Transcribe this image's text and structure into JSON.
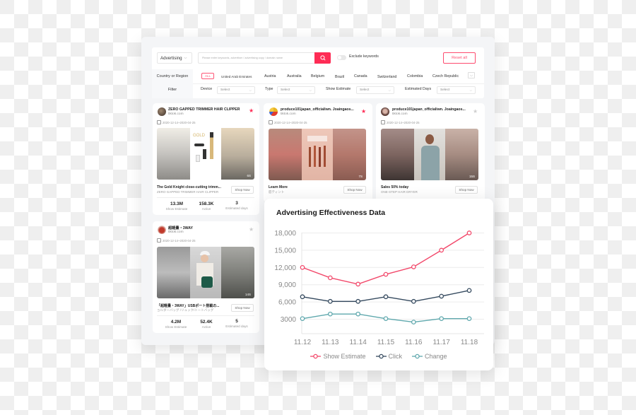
{
  "search": {
    "type_select": "Advertising",
    "placeholder": "Please enter keywords, advertiser / advertising copy / domain name",
    "exclude_label": "Exclude keywords",
    "reset_label": "Reset all"
  },
  "country_filter": {
    "label": "Country or Region",
    "options": [
      "ALL",
      "United Arab Emirates",
      "Austria",
      "Australia",
      "Belgium",
      "Brazil",
      "Canada",
      "Switzerland",
      "Colombia",
      "Czech Republic"
    ]
  },
  "filters": {
    "label": "Filter",
    "items": [
      {
        "label": "Device",
        "value": "Select"
      },
      {
        "label": "Type",
        "value": "Select"
      },
      {
        "label": "Show Estimate",
        "value": "Select"
      },
      {
        "label": "Estimated Days",
        "value": "Select"
      }
    ]
  },
  "ads": [
    {
      "title": "ZERO GAPPED TRIMMER HAIR CLIPPER",
      "domain": "tiktok.com",
      "starred": true,
      "date": "2020-12-14~2020-04-25",
      "duration": "6S",
      "caption": "The Gold Knight close-cutting trimm...",
      "sub": "ZERO GAPPED TRIMMER HAIR CLIPPER",
      "shop_label": "Shop Now",
      "stats": [
        {
          "value": "13.3M",
          "label": "Show Estimate"
        },
        {
          "value": "158.3K",
          "label": "Active"
        },
        {
          "value": "3",
          "label": "Estimated days"
        }
      ]
    },
    {
      "title": "produce101japan_officialiwn. Joaingaos...",
      "domain": "tiktok.com",
      "starred": true,
      "date": "2020-12-14~2020-04-25",
      "duration": "7S",
      "caption": "Learn More",
      "sub": "唇ティント",
      "shop_label": "Shop Now"
    },
    {
      "title": "produce101japan_officialiwn. Joaingaos...",
      "domain": "tiktok.com",
      "starred": false,
      "date": "2020-12-14~2020-04-25",
      "duration": "15S",
      "caption": "Sales 50% today",
      "sub": "ONE-STEP HAIR DRYER",
      "shop_label": "Shop Now"
    },
    {
      "title": "超軽量・3WAY",
      "domain": "tiktok.com",
      "starred": false,
      "date": "2020-12-14~2020-04-25",
      "duration": "14S",
      "caption": "「超軽量・3WAY」USBポート搭載の...",
      "sub": "ョルダーバッグ /リュック/トートバッグ",
      "shop_label": "Shop Now",
      "stats": [
        {
          "value": "4.2M",
          "label": "Show Estimate"
        },
        {
          "value": "52.4K",
          "label": "Active"
        },
        {
          "value": "5",
          "label": "Estimated days"
        }
      ]
    }
  ],
  "colors": {
    "accent": "#fe2c55",
    "show_estimate": "#f2496b",
    "click": "#34495e",
    "change": "#5fa8ad"
  },
  "chart_data": {
    "type": "line",
    "title": "Advertising Effectiveness Data",
    "x": [
      "11.12",
      "11.13",
      "11.14",
      "11.15",
      "11.16",
      "11.17",
      "11.18"
    ],
    "yticks": [
      3000,
      6000,
      9000,
      12000,
      15000,
      18000
    ],
    "ytick_labels": [
      "3000",
      "6,000",
      "9,000",
      "12,000",
      "15,000",
      "18,000"
    ],
    "ylim": [
      1500,
      18000
    ],
    "grid": true,
    "legend": "bottom",
    "series": [
      {
        "name": "Show Estimate",
        "color": "#f2496b",
        "values": [
          12000,
          10200,
          9100,
          10800,
          12100,
          15000,
          18000
        ]
      },
      {
        "name": "Click",
        "color": "#34495e",
        "values": [
          6900,
          6100,
          6100,
          6900,
          6100,
          7000,
          8000
        ]
      },
      {
        "name": "Change",
        "color": "#5fa8ad",
        "values": [
          3100,
          3900,
          3900,
          3100,
          2500,
          3100,
          3100
        ]
      }
    ]
  }
}
